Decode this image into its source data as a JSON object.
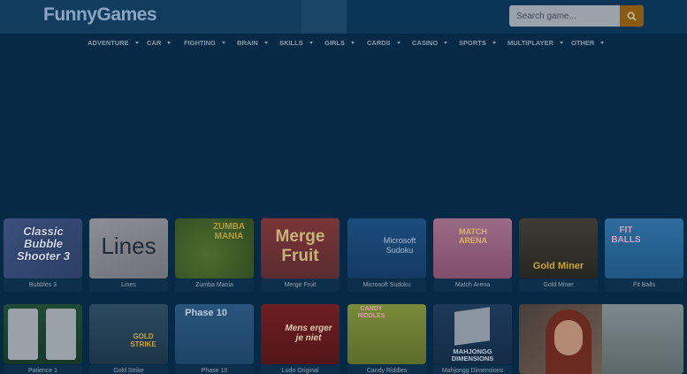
{
  "header": {
    "logo": "FunnyGames"
  },
  "search": {
    "placeholder": "Search game..."
  },
  "nav": [
    {
      "label": "ADVENTURE"
    },
    {
      "label": "CAR"
    },
    {
      "label": "FIGHTING"
    },
    {
      "label": "BRAIN"
    },
    {
      "label": "SKILLS"
    },
    {
      "label": "GIRLS"
    },
    {
      "label": "CARDS"
    },
    {
      "label": "CASINO"
    },
    {
      "label": "SPORTS"
    },
    {
      "label": "MULTIPLAYER"
    },
    {
      "label": "OTHER"
    }
  ],
  "games_row1": [
    {
      "title": "Bubbles 3",
      "art": "Classic Bubble Shooter 3"
    },
    {
      "title": "Lines",
      "art": "Lines"
    },
    {
      "title": "Zumba Mania",
      "art": "ZUMBA MANIA"
    },
    {
      "title": "Merge Fruit",
      "art": "Merge Fruit"
    },
    {
      "title": "Microsoft Sudoku",
      "art": "Microsoft Sudoku"
    },
    {
      "title": "Match Arena",
      "art": "MATCH ARENA"
    },
    {
      "title": "Gold Miner",
      "art": "Gold Miner"
    },
    {
      "title": "Fit Balls",
      "art": "FIT BALLS"
    }
  ],
  "games_row2": [
    {
      "title": "Patience 1",
      "art": ""
    },
    {
      "title": "Gold Strike",
      "art": "GOLD STRIKE"
    },
    {
      "title": "Phase 10",
      "art": "Phase 10"
    },
    {
      "title": "Ludo Original",
      "art": "Mens erger je niet"
    },
    {
      "title": "Candy Riddles",
      "art": "CANDY RIDDLES"
    },
    {
      "title": "Mahjongg Dimensions",
      "art": "MAHJONGG DIMENSIONS"
    }
  ],
  "colors": {
    "background": "#062a45",
    "header": "#0a3557",
    "search_button": "#8a5a10"
  }
}
